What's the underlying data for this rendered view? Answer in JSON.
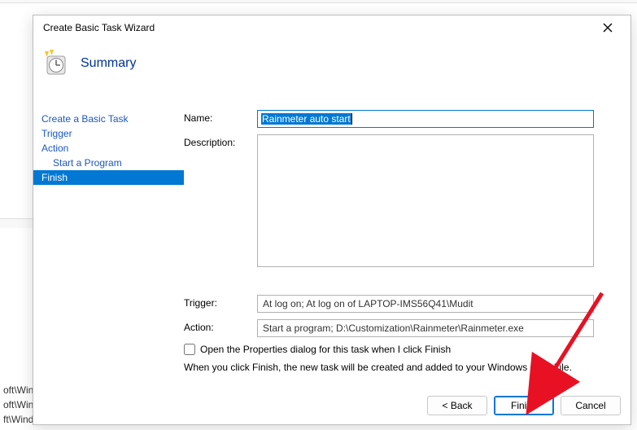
{
  "window_title": "Create Basic Task Wizard",
  "header_title": "Summary",
  "nav": {
    "items": [
      {
        "label": "Create a Basic Task",
        "indent": false,
        "selected": false
      },
      {
        "label": "Trigger",
        "indent": false,
        "selected": false
      },
      {
        "label": "Action",
        "indent": false,
        "selected": false
      },
      {
        "label": "Start a Program",
        "indent": true,
        "selected": false
      },
      {
        "label": "Finish",
        "indent": false,
        "selected": true
      }
    ]
  },
  "labels": {
    "name": "Name:",
    "description": "Description:",
    "trigger": "Trigger:",
    "action": "Action:"
  },
  "fields": {
    "name_value": "Rainmeter auto start",
    "description_value": "",
    "trigger_value": "At log on; At log on of LAPTOP-IMS56Q41\\Mudit",
    "action_value": "Start a program; D:\\Customization\\Rainmeter\\Rainmeter.exe"
  },
  "open_properties_label": "Open the Properties dialog for this task when I click Finish",
  "open_properties_checked": false,
  "hint_text": "When you click Finish, the new task will be created and added to your Windows schedule.",
  "buttons": {
    "back": "< Back",
    "finish": "Finish",
    "cancel": "Cancel"
  },
  "bg_tree": {
    "l1": "oft\\Wind…",
    "l2": "oft\\Windows\\U…",
    "l3": "ft\\Windows\\Fl…"
  }
}
